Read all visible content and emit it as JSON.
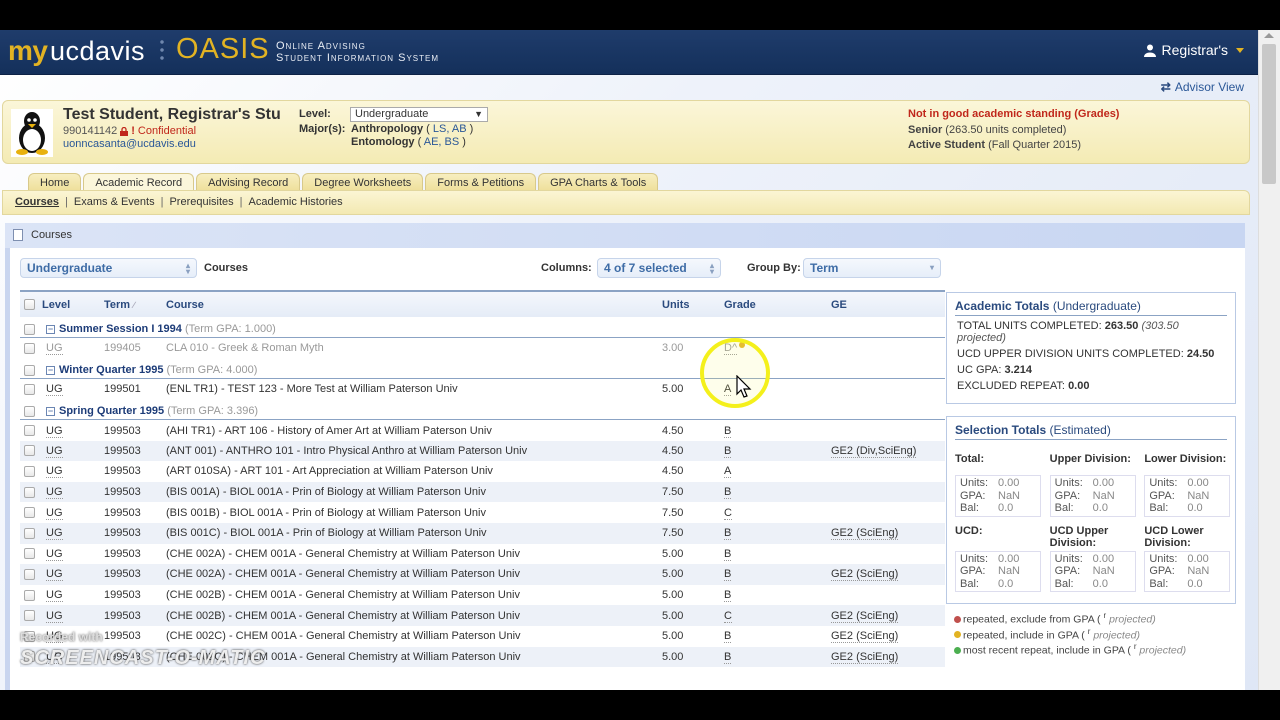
{
  "header": {
    "logo_my": "my",
    "logo_ucdavis": "ucdavis",
    "logo_oasis": "OASIS",
    "logo_sub_line1": "Online Advising",
    "logo_sub_line2": "Student Information System",
    "user_menu_label": "Registrar's",
    "advisor_view_label": "Advisor View"
  },
  "student": {
    "name": "Test Student, Registrar's Stu",
    "id": "990141142",
    "confidential_label": "Confidential",
    "email": "uonncasanta@ucdavis.edu",
    "level_label": "Level:",
    "level_value": "Undergraduate",
    "majors_label": "Major(s):",
    "majors": [
      {
        "name": "Anthropology",
        "codes": "LS, AB"
      },
      {
        "name": "Entomology",
        "codes": "AE, BS"
      }
    ],
    "standing_alert": "Not in good academic standing (Grades)",
    "class_level": "Senior",
    "class_detail": "(263.50 units completed)",
    "status": "Active Student",
    "status_detail": "(Fall Quarter 2015)"
  },
  "tabs": [
    {
      "label": "Home",
      "active": false
    },
    {
      "label": "Academic Record",
      "active": true
    },
    {
      "label": "Advising Record",
      "active": false
    },
    {
      "label": "Degree Worksheets",
      "active": false
    },
    {
      "label": "Forms & Petitions",
      "active": false
    },
    {
      "label": "GPA Charts & Tools",
      "active": false
    }
  ],
  "subnav": [
    {
      "label": "Courses",
      "active": true
    },
    {
      "label": "Exams & Events",
      "active": false
    },
    {
      "label": "Prerequisites",
      "active": false
    },
    {
      "label": "Academic Histories",
      "active": false
    }
  ],
  "courses_panel": {
    "title": "Courses",
    "level_filter": "Undergraduate",
    "level_suffix": "Courses",
    "columns_label": "Columns:",
    "columns_value": "4 of 7 selected",
    "group_by_label": "Group By:",
    "group_by_value": "Term",
    "headers": {
      "level": "Level",
      "term": "Term",
      "course": "Course",
      "units": "Units",
      "grade": "Grade",
      "ge": "GE"
    }
  },
  "groups": [
    {
      "term": "Summer Session I 1994",
      "gpa": "(Term GPA: 1.000)",
      "rows": [
        {
          "level": "UG",
          "term": "199405",
          "course": "CLA 010 - Greek & Roman Myth",
          "units": "3.00",
          "grade": "D^",
          "ge": "",
          "dim": true,
          "repeat_marker": "repeated-include"
        }
      ]
    },
    {
      "term": "Winter Quarter 1995",
      "gpa": "(Term GPA: 4.000)",
      "rows": [
        {
          "level": "UG",
          "term": "199501",
          "course": "(ENL TR1) - TEST 123 - More Test at William Paterson Univ",
          "units": "5.00",
          "grade": "A",
          "ge": ""
        }
      ]
    },
    {
      "term": "Spring Quarter 1995",
      "gpa": "(Term GPA: 3.396)",
      "rows": [
        {
          "level": "UG",
          "term": "199503",
          "course": "(AHI TR1) - ART 106 - History of Amer Art at William Paterson Univ",
          "units": "4.50",
          "grade": "B",
          "ge": ""
        },
        {
          "level": "UG",
          "term": "199503",
          "course": "(ANT 001) - ANTHRO 101 - Intro Physical Anthro at William Paterson Univ",
          "units": "4.50",
          "grade": "B",
          "ge": "GE2 (Div,SciEng)"
        },
        {
          "level": "UG",
          "term": "199503",
          "course": "(ART 010SA) - ART 101 - Art Appreciation at William Paterson Univ",
          "units": "4.50",
          "grade": "A",
          "ge": ""
        },
        {
          "level": "UG",
          "term": "199503",
          "course": "(BIS 001A) - BIOL 001A - Prin of Biology at William Paterson Univ",
          "units": "7.50",
          "grade": "B",
          "ge": ""
        },
        {
          "level": "UG",
          "term": "199503",
          "course": "(BIS 001B) - BIOL 001A - Prin of Biology at William Paterson Univ",
          "units": "7.50",
          "grade": "C",
          "ge": ""
        },
        {
          "level": "UG",
          "term": "199503",
          "course": "(BIS 001C) - BIOL 001A - Prin of Biology at William Paterson Univ",
          "units": "7.50",
          "grade": "B",
          "ge": "GE2 (SciEng)"
        },
        {
          "level": "UG",
          "term": "199503",
          "course": "(CHE 002A) - CHEM 001A - General Chemistry at William Paterson Univ",
          "units": "5.00",
          "grade": "B",
          "ge": ""
        },
        {
          "level": "UG",
          "term": "199503",
          "course": "(CHE 002A) - CHEM 001A - General Chemistry at William Paterson Univ",
          "units": "5.00",
          "grade": "B",
          "ge": "GE2 (SciEng)"
        },
        {
          "level": "UG",
          "term": "199503",
          "course": "(CHE 002B) - CHEM 001A - General Chemistry at William Paterson Univ",
          "units": "5.00",
          "grade": "B",
          "ge": ""
        },
        {
          "level": "UG",
          "term": "199503",
          "course": "(CHE 002B) - CHEM 001A - General Chemistry at William Paterson Univ",
          "units": "5.00",
          "grade": "C",
          "ge": "GE2 (SciEng)"
        },
        {
          "level": "UG",
          "term": "199503",
          "course": "(CHE 002C) - CHEM 001A - General Chemistry at William Paterson Univ",
          "units": "5.00",
          "grade": "B",
          "ge": "GE2 (SciEng)"
        },
        {
          "level": "UG",
          "term": "199503",
          "course": "(CHE 002C) - CHEM 001A - General Chemistry at William Paterson Univ",
          "units": "5.00",
          "grade": "B",
          "ge": "GE2 (SciEng)"
        }
      ]
    }
  ],
  "academic_totals": {
    "title": "Academic Totals",
    "title_suffix": "(Undergraduate)",
    "total_units_label": "TOTAL UNITS COMPLETED:",
    "total_units_value": "263.50",
    "total_units_projected": "(303.50 projected)",
    "ucd_upper_label": "UCD UPPER DIVISION UNITS COMPLETED:",
    "ucd_upper_value": "24.50",
    "uc_gpa_label": "UC GPA:",
    "uc_gpa_value": "3.214",
    "excluded_label": "EXCLUDED REPEAT:",
    "excluded_value": "0.00"
  },
  "selection_totals": {
    "title": "Selection Totals",
    "title_suffix": "(Estimated)",
    "groups": [
      {
        "label": "Total:",
        "units": "0.00",
        "gpa": "NaN",
        "bal": "0.0"
      },
      {
        "label": "Upper Division:",
        "units": "0.00",
        "gpa": "NaN",
        "bal": "0.0"
      },
      {
        "label": "Lower Division:",
        "units": "0.00",
        "gpa": "NaN",
        "bal": "0.0"
      },
      {
        "label": "UCD:",
        "units": "0.00",
        "gpa": "NaN",
        "bal": "0.0"
      },
      {
        "label": "UCD Upper Division:",
        "units": "0.00",
        "gpa": "NaN",
        "bal": "0.0"
      },
      {
        "label": "UCD Lower Division:",
        "units": "0.00",
        "gpa": "NaN",
        "bal": "0.0"
      }
    ],
    "units_label": "Units:",
    "gpa_label": "GPA:",
    "bal_label": "Bal:"
  },
  "legend": [
    {
      "text": "repeated, exclude from GPA (",
      "projected": "projected)",
      "color": "#c0504d"
    },
    {
      "text": "repeated, include in GPA (",
      "projected": "projected)",
      "color": "#e2b323"
    },
    {
      "text": "most recent repeat, include in GPA (",
      "projected": "projected)",
      "color": "#4caf50"
    }
  ],
  "watermark": {
    "line1": "Recorded with",
    "line2": "SCREENCAST-O-MATIC"
  }
}
